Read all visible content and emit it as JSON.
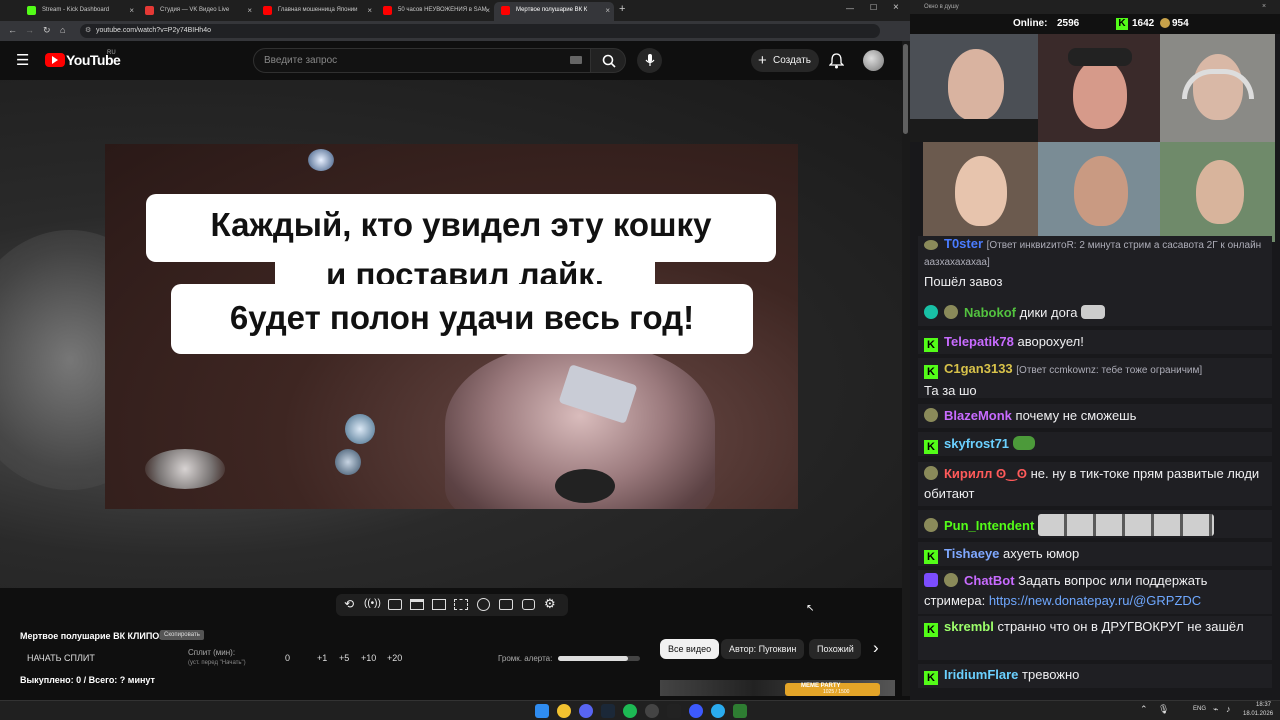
{
  "browser": {
    "tabs": [
      {
        "label": "Stream - Kick Dashboard",
        "fav_color": "#53fc18"
      },
      {
        "label": "Студия — VK Видео Live",
        "fav_color": "#e53935"
      },
      {
        "label": "Главная мошенница Японии",
        "fav_color": "#ff0000"
      },
      {
        "label": "50 часов НЕУВОЖЕНИЯ в SAM",
        "fav_color": "#ff0000"
      },
      {
        "label": "Мертвое полушарие ВК К",
        "fav_color": "#ff0000"
      }
    ],
    "close_glyph": "×",
    "new_tab_glyph": "+",
    "url": "youtube.com/watch?v=P2y74BIHh4o"
  },
  "youtube": {
    "logo_text": "YouTube",
    "region": "RU",
    "search_placeholder": "Введите запрос",
    "create_label": "Создать",
    "accent_color": "#ff0000"
  },
  "video": {
    "caption_lines": [
      "Каждый, кто увидел эту кошку",
      "и поставил лайк,",
      "6удет полон удачи весь год!"
    ]
  },
  "plugin": {
    "title": "Мертвое полушарие ВК КЛИПОВ",
    "tag": "Скопировать",
    "start_split": "НАЧАТЬ СПЛИТ",
    "split_label": "Сплит (мин):",
    "split_hint": "(уст. перед \"Начать\")",
    "split_value": "0",
    "increments": [
      "+1",
      "+5",
      "+10",
      "+20"
    ],
    "volume_label": "Громк. алерта:",
    "volume_level": 0.85,
    "bought_summary": "Выкуплено: 0 / Всего: ? минут"
  },
  "filters": {
    "chips": [
      "Все видео",
      "Автор: Пугоквин",
      "Похожий"
    ],
    "next_glyph": "›"
  },
  "recommendation_banner": {
    "badge_text": "MEME PARTY",
    "progress_text": "1025 / 1500"
  },
  "overlay": {
    "window_title": "Окно в душу",
    "online_label": "Online:",
    "online_count": "2596",
    "followers_count": "1642",
    "subs_count": "954"
  },
  "chat": {
    "messages": [
      {
        "user": "T0ster",
        "user_color": "#4a7cff",
        "reply": "[Ответ инквиzитоR: 2 минута стрим а сасавота 2Г к онлайн аазхахахахаа]",
        "text": "Пошёл завоз",
        "badge": "emote"
      },
      {
        "user": "Nabokof",
        "user_color": "#53c23f",
        "text": "дики дога",
        "badge": "verified"
      },
      {
        "user": "Telepatik78",
        "user_color": "#c86bff",
        "text": "аворохуел!",
        "badge": "kick"
      },
      {
        "user": "C1gan3133",
        "user_color": "#d8c24a",
        "reply": "[Ответ ccmkownz: тебе тоже ограничим]",
        "text": "Та за шо",
        "badge": "kick"
      },
      {
        "user": "BlazeMonk",
        "user_color": "#c86bff",
        "text": "почему не сможешь",
        "badge": "emote"
      },
      {
        "user": "skyfrost71",
        "user_color": "#6bd0ff",
        "text": "",
        "badge": "kick"
      },
      {
        "user": "Кирилл ʘ‿ʘ",
        "user_color": "#ff5a5a",
        "text": "не. ну в тик-токе прям развитые люди обитают",
        "badge": "emote"
      },
      {
        "user": "Pun_Intendent",
        "user_color": "#53fc18",
        "text": "",
        "badge": "emote"
      },
      {
        "user": "Tishaeye",
        "user_color": "#7fa8ff",
        "text": "ахуеть юмор",
        "badge": "kick"
      },
      {
        "user": "ChatBot",
        "user_color": "#c86bff",
        "text": "Задать вопрос или поддержать стримера:",
        "link": "https://new.donatepay.ru/@GRPZDC",
        "badge": "bot"
      },
      {
        "user": "skrembl",
        "user_color": "#9dff6b",
        "text": "странно что он в ДРУГВОКРУГ не зашёл",
        "badge": "kick"
      },
      {
        "user": "IridiumFlare",
        "user_color": "#6bd0ff",
        "text": "тревожно",
        "badge": "kick"
      }
    ]
  },
  "taskbar": {
    "lang": "ENG",
    "time": "18:37",
    "date": "18.01.2026"
  }
}
